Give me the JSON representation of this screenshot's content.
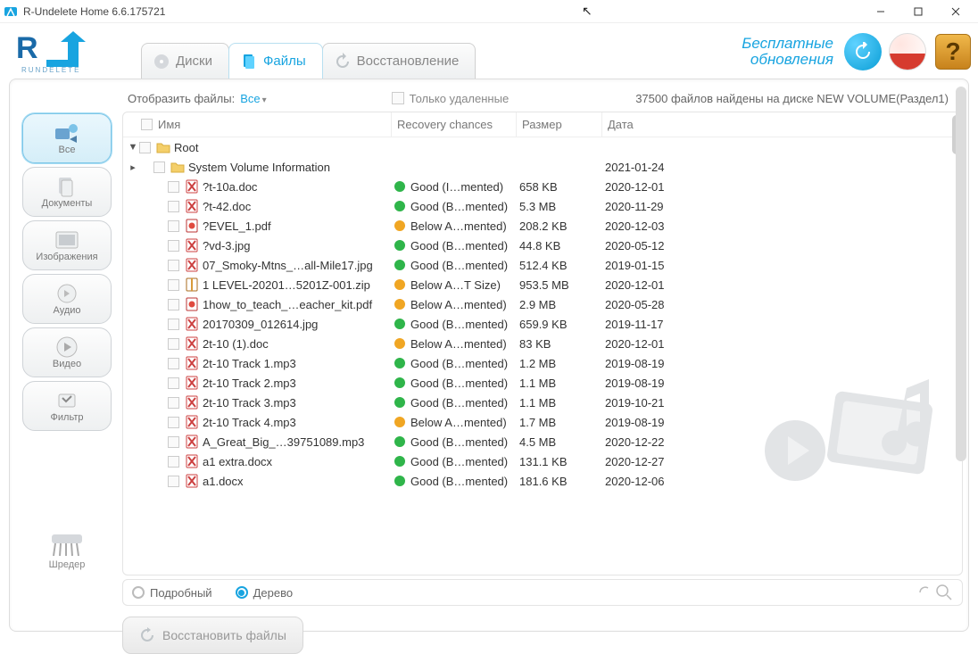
{
  "app": {
    "title": "R-Undelete Home 6.6.175721"
  },
  "header": {
    "tabs": {
      "disks": "Диски",
      "files": "Файлы",
      "recover": "Восстановление"
    },
    "updates_line1": "Бесплатные",
    "updates_line2": "обновления"
  },
  "filterbar": {
    "show_label": "Отобразить файлы:",
    "show_value": "Все",
    "deleted_only": "Только удаленные",
    "count_text": "37500 файлов найдены на диске NEW VOLUME(Раздел1)"
  },
  "sidebar": {
    "items": [
      {
        "label": "Все"
      },
      {
        "label": "Документы"
      },
      {
        "label": "Изображения"
      },
      {
        "label": "Аудио"
      },
      {
        "label": "Видео"
      },
      {
        "label": "Фильтр"
      }
    ],
    "shredder": "Шредер"
  },
  "columns": {
    "name": "Имя",
    "recovery": "Recovery chances",
    "size": "Размер",
    "date": "Дата"
  },
  "rows": [
    {
      "type": "folder-root",
      "indent": 0,
      "name": "Root",
      "rec": "",
      "dot": "",
      "size": "",
      "date": ""
    },
    {
      "type": "folder",
      "indent": 1,
      "name": "System Volume Information",
      "rec": "",
      "dot": "",
      "size": "",
      "date": "2021-01-24"
    },
    {
      "type": "file-bad",
      "indent": 2,
      "name": "?t-10a.doc",
      "dot": "green",
      "rec": "Good (I…mented)",
      "size": "658 KB",
      "date": "2020-12-01"
    },
    {
      "type": "file-bad",
      "indent": 2,
      "name": "?t-42.doc",
      "dot": "green",
      "rec": "Good (B…mented)",
      "size": "5.3 MB",
      "date": "2020-11-29"
    },
    {
      "type": "file-pdf",
      "indent": 2,
      "name": "?EVEL_1.pdf",
      "dot": "orange",
      "rec": "Below A…mented)",
      "size": "208.2 KB",
      "date": "2020-12-03"
    },
    {
      "type": "file-bad",
      "indent": 2,
      "name": "?vd-3.jpg",
      "dot": "green",
      "rec": "Good (B…mented)",
      "size": "44.8 KB",
      "date": "2020-05-12"
    },
    {
      "type": "file-bad",
      "indent": 2,
      "name": "07_Smoky-Mtns_…all-Mile17.jpg",
      "dot": "green",
      "rec": "Good (B…mented)",
      "size": "512.4 KB",
      "date": "2019-01-15"
    },
    {
      "type": "file-zip",
      "indent": 2,
      "name": "1 LEVEL-20201…5201Z-001.zip",
      "dot": "orange",
      "rec": "Below A…T Size)",
      "size": "953.5 MB",
      "date": "2020-12-01"
    },
    {
      "type": "file-pdf",
      "indent": 2,
      "name": "1how_to_teach_…eacher_kit.pdf",
      "dot": "orange",
      "rec": "Below A…mented)",
      "size": "2.9 MB",
      "date": "2020-05-28"
    },
    {
      "type": "file-bad",
      "indent": 2,
      "name": "20170309_012614.jpg",
      "dot": "green",
      "rec": "Good (B…mented)",
      "size": "659.9 KB",
      "date": "2019-11-17"
    },
    {
      "type": "file-bad",
      "indent": 2,
      "name": "2t-10 (1).doc",
      "dot": "orange",
      "rec": "Below A…mented)",
      "size": "83 KB",
      "date": "2020-12-01"
    },
    {
      "type": "file-bad",
      "indent": 2,
      "name": "2t-10 Track 1.mp3",
      "dot": "green",
      "rec": "Good (B…mented)",
      "size": "1.2 MB",
      "date": "2019-08-19"
    },
    {
      "type": "file-bad",
      "indent": 2,
      "name": "2t-10 Track 2.mp3",
      "dot": "green",
      "rec": "Good (B…mented)",
      "size": "1.1 MB",
      "date": "2019-08-19"
    },
    {
      "type": "file-bad",
      "indent": 2,
      "name": "2t-10 Track 3.mp3",
      "dot": "green",
      "rec": "Good (B…mented)",
      "size": "1.1 MB",
      "date": "2019-10-21"
    },
    {
      "type": "file-bad",
      "indent": 2,
      "name": "2t-10 Track 4.mp3",
      "dot": "orange",
      "rec": "Below A…mented)",
      "size": "1.7 MB",
      "date": "2019-08-19"
    },
    {
      "type": "file-bad",
      "indent": 2,
      "name": "A_Great_Big_…39751089.mp3",
      "dot": "green",
      "rec": "Good (B…mented)",
      "size": "4.5 MB",
      "date": "2020-12-22"
    },
    {
      "type": "file-bad",
      "indent": 2,
      "name": "a1 extra.docx",
      "dot": "green",
      "rec": "Good (B…mented)",
      "size": "131.1 KB",
      "date": "2020-12-27"
    },
    {
      "type": "file-bad",
      "indent": 2,
      "name": "a1.docx",
      "dot": "green",
      "rec": "Good (B…mented)",
      "size": "181.6 KB",
      "date": "2020-12-06"
    }
  ],
  "viewbar": {
    "detailed": "Подробный",
    "tree": "Дерево"
  },
  "recover_button": "Восстановить файлы"
}
